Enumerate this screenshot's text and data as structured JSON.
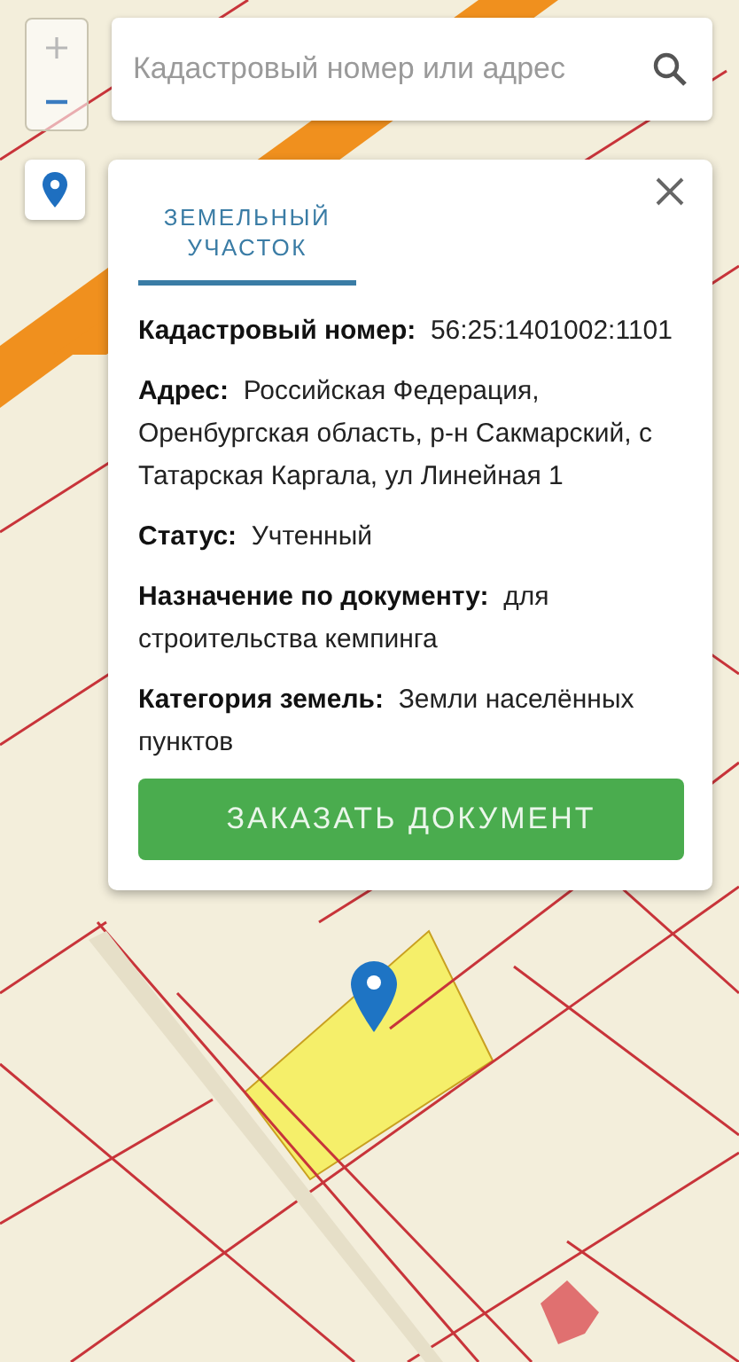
{
  "search": {
    "placeholder": "Кадастровый номер или адрес"
  },
  "card": {
    "tabs": [
      {
        "label": "ЗЕМЕЛЬНЫЙ УЧАСТОК",
        "selected": true
      }
    ],
    "fields": [
      {
        "label": "Кадастровый номер:",
        "value": "56:25:1401002:1101"
      },
      {
        "label": "Адрес:",
        "value": "Российская Федерация, Оренбургская область, р-н Сакмарский, с Татарская Каргала, ул Линейная 1"
      },
      {
        "label": "Статус:",
        "value": "Учтенный"
      },
      {
        "label": "Назначение по документу:",
        "value": "для строительства кемпинга"
      },
      {
        "label": "Категория земель:",
        "value": "Земли населённых пунктов"
      }
    ],
    "button": "ЗАКАЗАТЬ ДОКУМЕНТ"
  }
}
